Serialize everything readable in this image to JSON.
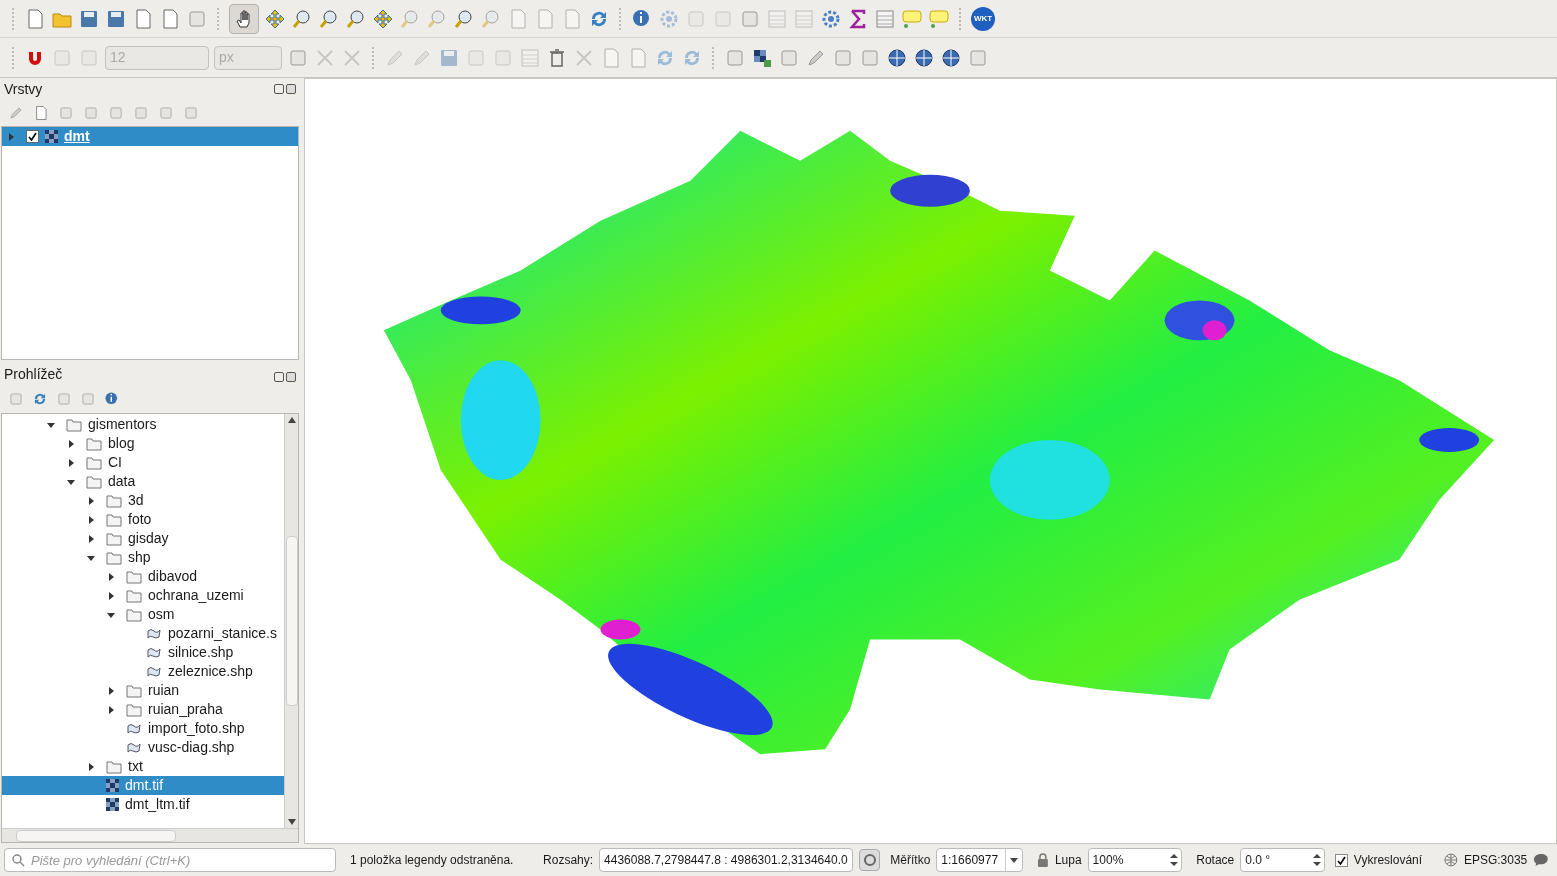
{
  "toolbars": {
    "snapping_tolerance": "12",
    "snapping_unit": "px",
    "wkt_label": "WKT"
  },
  "layers_panel": {
    "title": "Vrstvy",
    "layers": [
      {
        "name": "dmt",
        "checked": true,
        "selected": true,
        "expanded": false
      }
    ]
  },
  "browser_panel": {
    "title": "Prohlížeč",
    "tree": [
      {
        "name": "gismentors",
        "kind": "folder",
        "expanded": true,
        "selected": false,
        "children": [
          {
            "name": "blog",
            "kind": "folder",
            "expanded": false,
            "selected": false
          },
          {
            "name": "CI",
            "kind": "folder",
            "expanded": false,
            "selected": false
          },
          {
            "name": "data",
            "kind": "folder",
            "expanded": true,
            "selected": false,
            "children": [
              {
                "name": "3d",
                "kind": "folder",
                "expanded": false,
                "selected": false
              },
              {
                "name": "foto",
                "kind": "folder",
                "expanded": false,
                "selected": false
              },
              {
                "name": "gisday",
                "kind": "folder",
                "expanded": false,
                "selected": false
              },
              {
                "name": "shp",
                "kind": "folder",
                "expanded": true,
                "selected": false,
                "children": [
                  {
                    "name": "dibavod",
                    "kind": "folder",
                    "expanded": false,
                    "selected": false
                  },
                  {
                    "name": "ochrana_uzemi",
                    "kind": "folder",
                    "expanded": false,
                    "selected": false
                  },
                  {
                    "name": "osm",
                    "kind": "folder",
                    "expanded": true,
                    "selected": false,
                    "children": [
                      {
                        "name": "pozarni_stanice.s",
                        "kind": "vector",
                        "selected": false
                      },
                      {
                        "name": "silnice.shp",
                        "kind": "vector",
                        "selected": false
                      },
                      {
                        "name": "zeleznice.shp",
                        "kind": "vector",
                        "selected": false
                      }
                    ]
                  },
                  {
                    "name": "ruian",
                    "kind": "folder",
                    "expanded": false,
                    "selected": false
                  },
                  {
                    "name": "ruian_praha",
                    "kind": "folder",
                    "expanded": false,
                    "selected": false
                  },
                  {
                    "name": "import_foto.shp",
                    "kind": "vector",
                    "selected": false
                  },
                  {
                    "name": "vusc-diag.shp",
                    "kind": "vector",
                    "selected": false
                  }
                ]
              },
              {
                "name": "txt",
                "kind": "folder",
                "expanded": false,
                "selected": false
              },
              {
                "name": "dmt.tif",
                "kind": "raster",
                "selected": true
              },
              {
                "name": "dmt_ltm.tif",
                "kind": "raster",
                "selected": false
              }
            ]
          }
        ]
      }
    ]
  },
  "status_bar": {
    "search_placeholder": "Pište pro vyhledání (Ctrl+K)",
    "message": "1 položka legendy odstraněna.",
    "extents_label": "Rozsahy:",
    "extents": "4436088.7,2798447.8 : 4986301.2,3134640.0",
    "scale_label": "Měřítko",
    "scale": "1:1660977",
    "magnifier_label": "Lupa",
    "magnifier": "100%",
    "rotation_label": "Rotace",
    "rotation": "0.0 °",
    "render_checked": true,
    "render_label": "Vykreslování",
    "crs": "EPSG:3035"
  }
}
